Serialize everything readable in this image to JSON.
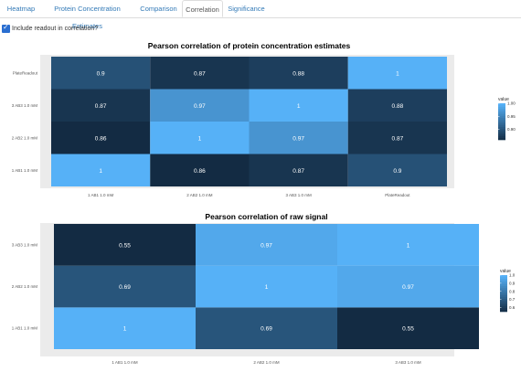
{
  "tabs": [
    {
      "label": "Heatmap",
      "active": false
    },
    {
      "label": "Protein Concentration Estimates",
      "active": false
    },
    {
      "label": "Comparison",
      "active": false
    },
    {
      "label": "Correlation",
      "active": true
    },
    {
      "label": "Significance",
      "active": false
    }
  ],
  "checkbox": {
    "label": "Include readout in correlation?",
    "checked": true
  },
  "colors": {
    "low": "#132b43",
    "high": "#56b1f7",
    "panel": "#ebebeb",
    "tab_link": "#337ab7"
  },
  "chart_data": [
    {
      "type": "heatmap",
      "title": "Pearson correlation of protein concentration estimates",
      "x_categories": [
        "1 AB1 1.0 mM",
        "2 AB2 1.0 mM",
        "3 AB3 1.0 mM",
        "PlateReadout"
      ],
      "y_categories": [
        "1 AB1 1.0 mM",
        "2 AB2 1.0 mM",
        "3 AB3 1.0 mM",
        "PlateReadout"
      ],
      "values": [
        [
          1,
          0.86,
          0.87,
          0.9
        ],
        [
          0.86,
          1,
          0.97,
          0.87
        ],
        [
          0.87,
          0.97,
          1,
          0.88
        ],
        [
          0.9,
          0.87,
          0.88,
          1
        ]
      ],
      "labels": [
        [
          "1",
          "0.86",
          "0.87",
          "0.9"
        ],
        [
          "0.86",
          "1",
          "0.97",
          "0.87"
        ],
        [
          "0.87",
          "0.97",
          "1",
          "0.88"
        ],
        [
          "0.9",
          "0.87",
          "0.88",
          "1"
        ]
      ],
      "legend": {
        "title": "value",
        "ticks": [
          1.0,
          0.95,
          0.9
        ],
        "tick_labels": [
          "1.00",
          "0.95",
          "0.90"
        ],
        "range": [
          0.86,
          1.0
        ],
        "position": "right"
      }
    },
    {
      "type": "heatmap",
      "title": "Pearson correlation of raw signal",
      "x_categories": [
        "1 AB1 1.0 mM",
        "2 AB2 1.0 mM",
        "3 AB3 1.0 mM"
      ],
      "y_categories": [
        "1 AB1 1.0 mM",
        "2 AB2 1.0 mM",
        "3 AB3 1.0 mM"
      ],
      "values": [
        [
          1,
          0.69,
          0.55
        ],
        [
          0.69,
          1,
          0.97
        ],
        [
          0.55,
          0.97,
          1
        ]
      ],
      "labels": [
        [
          "1",
          "0.69",
          "0.55"
        ],
        [
          "0.69",
          "1",
          "0.97"
        ],
        [
          "0.55",
          "0.97",
          "1"
        ]
      ],
      "legend": {
        "title": "value",
        "ticks": [
          1.0,
          0.9,
          0.8,
          0.7,
          0.6
        ],
        "tick_labels": [
          "1.0",
          "0.9",
          "0.8",
          "0.7",
          "0.6"
        ],
        "range": [
          0.55,
          1.0
        ],
        "position": "right"
      }
    }
  ]
}
